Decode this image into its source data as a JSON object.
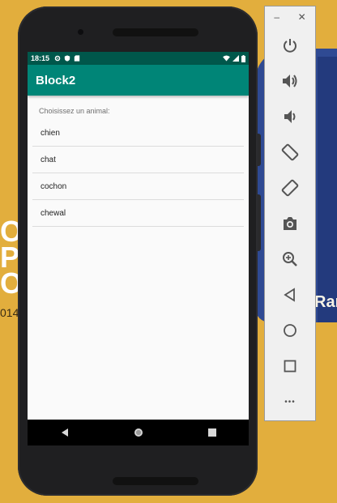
{
  "wallpaper": {
    "text_left": "O A\nP\nO",
    "text_left_small": "014",
    "text_right": "Ran"
  },
  "statusbar": {
    "time": "18:15"
  },
  "app": {
    "title": "Block2",
    "prompt": "Choisissez un animal:",
    "items": [
      "chien",
      "chat",
      "cochon",
      "chewal"
    ]
  },
  "toolbar": {
    "minimize": "–",
    "close": "✕",
    "more": "•••"
  },
  "colors": {
    "statusbar": "#00574b",
    "appbar": "#008577",
    "wallpaper": "#e2ae3d",
    "wallpaper_blue": "#2f4a93",
    "toolbar_icon": "#555555"
  }
}
